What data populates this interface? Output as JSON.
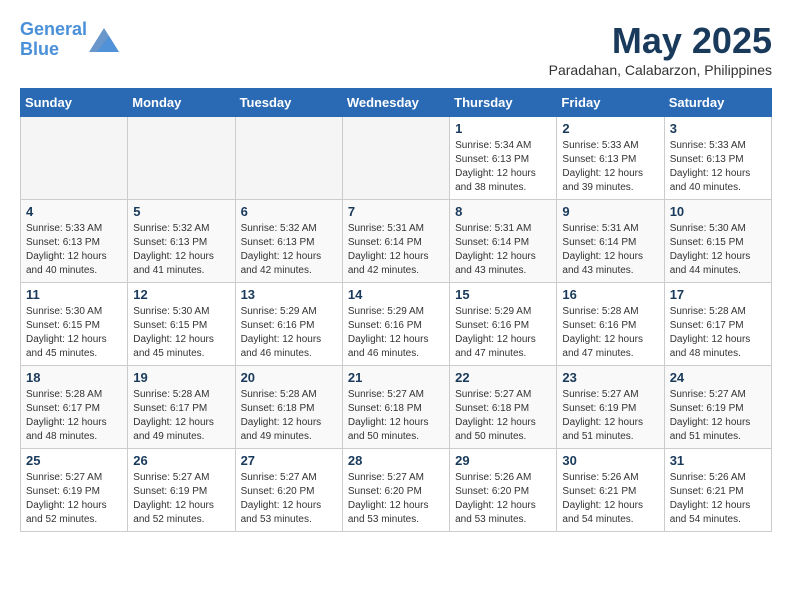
{
  "header": {
    "logo_line1": "General",
    "logo_line2": "Blue",
    "month_title": "May 2025",
    "subtitle": "Paradahan, Calabarzon, Philippines"
  },
  "days_of_week": [
    "Sunday",
    "Monday",
    "Tuesday",
    "Wednesday",
    "Thursday",
    "Friday",
    "Saturday"
  ],
  "weeks": [
    {
      "days": [
        {
          "num": "",
          "info": ""
        },
        {
          "num": "",
          "info": ""
        },
        {
          "num": "",
          "info": ""
        },
        {
          "num": "",
          "info": ""
        },
        {
          "num": "1",
          "info": "Sunrise: 5:34 AM\nSunset: 6:13 PM\nDaylight: 12 hours\nand 38 minutes."
        },
        {
          "num": "2",
          "info": "Sunrise: 5:33 AM\nSunset: 6:13 PM\nDaylight: 12 hours\nand 39 minutes."
        },
        {
          "num": "3",
          "info": "Sunrise: 5:33 AM\nSunset: 6:13 PM\nDaylight: 12 hours\nand 40 minutes."
        }
      ]
    },
    {
      "days": [
        {
          "num": "4",
          "info": "Sunrise: 5:33 AM\nSunset: 6:13 PM\nDaylight: 12 hours\nand 40 minutes."
        },
        {
          "num": "5",
          "info": "Sunrise: 5:32 AM\nSunset: 6:13 PM\nDaylight: 12 hours\nand 41 minutes."
        },
        {
          "num": "6",
          "info": "Sunrise: 5:32 AM\nSunset: 6:13 PM\nDaylight: 12 hours\nand 42 minutes."
        },
        {
          "num": "7",
          "info": "Sunrise: 5:31 AM\nSunset: 6:14 PM\nDaylight: 12 hours\nand 42 minutes."
        },
        {
          "num": "8",
          "info": "Sunrise: 5:31 AM\nSunset: 6:14 PM\nDaylight: 12 hours\nand 43 minutes."
        },
        {
          "num": "9",
          "info": "Sunrise: 5:31 AM\nSunset: 6:14 PM\nDaylight: 12 hours\nand 43 minutes."
        },
        {
          "num": "10",
          "info": "Sunrise: 5:30 AM\nSunset: 6:15 PM\nDaylight: 12 hours\nand 44 minutes."
        }
      ]
    },
    {
      "days": [
        {
          "num": "11",
          "info": "Sunrise: 5:30 AM\nSunset: 6:15 PM\nDaylight: 12 hours\nand 45 minutes."
        },
        {
          "num": "12",
          "info": "Sunrise: 5:30 AM\nSunset: 6:15 PM\nDaylight: 12 hours\nand 45 minutes."
        },
        {
          "num": "13",
          "info": "Sunrise: 5:29 AM\nSunset: 6:16 PM\nDaylight: 12 hours\nand 46 minutes."
        },
        {
          "num": "14",
          "info": "Sunrise: 5:29 AM\nSunset: 6:16 PM\nDaylight: 12 hours\nand 46 minutes."
        },
        {
          "num": "15",
          "info": "Sunrise: 5:29 AM\nSunset: 6:16 PM\nDaylight: 12 hours\nand 47 minutes."
        },
        {
          "num": "16",
          "info": "Sunrise: 5:28 AM\nSunset: 6:16 PM\nDaylight: 12 hours\nand 47 minutes."
        },
        {
          "num": "17",
          "info": "Sunrise: 5:28 AM\nSunset: 6:17 PM\nDaylight: 12 hours\nand 48 minutes."
        }
      ]
    },
    {
      "days": [
        {
          "num": "18",
          "info": "Sunrise: 5:28 AM\nSunset: 6:17 PM\nDaylight: 12 hours\nand 48 minutes."
        },
        {
          "num": "19",
          "info": "Sunrise: 5:28 AM\nSunset: 6:17 PM\nDaylight: 12 hours\nand 49 minutes."
        },
        {
          "num": "20",
          "info": "Sunrise: 5:28 AM\nSunset: 6:18 PM\nDaylight: 12 hours\nand 49 minutes."
        },
        {
          "num": "21",
          "info": "Sunrise: 5:27 AM\nSunset: 6:18 PM\nDaylight: 12 hours\nand 50 minutes."
        },
        {
          "num": "22",
          "info": "Sunrise: 5:27 AM\nSunset: 6:18 PM\nDaylight: 12 hours\nand 50 minutes."
        },
        {
          "num": "23",
          "info": "Sunrise: 5:27 AM\nSunset: 6:19 PM\nDaylight: 12 hours\nand 51 minutes."
        },
        {
          "num": "24",
          "info": "Sunrise: 5:27 AM\nSunset: 6:19 PM\nDaylight: 12 hours\nand 51 minutes."
        }
      ]
    },
    {
      "days": [
        {
          "num": "25",
          "info": "Sunrise: 5:27 AM\nSunset: 6:19 PM\nDaylight: 12 hours\nand 52 minutes."
        },
        {
          "num": "26",
          "info": "Sunrise: 5:27 AM\nSunset: 6:19 PM\nDaylight: 12 hours\nand 52 minutes."
        },
        {
          "num": "27",
          "info": "Sunrise: 5:27 AM\nSunset: 6:20 PM\nDaylight: 12 hours\nand 53 minutes."
        },
        {
          "num": "28",
          "info": "Sunrise: 5:27 AM\nSunset: 6:20 PM\nDaylight: 12 hours\nand 53 minutes."
        },
        {
          "num": "29",
          "info": "Sunrise: 5:26 AM\nSunset: 6:20 PM\nDaylight: 12 hours\nand 53 minutes."
        },
        {
          "num": "30",
          "info": "Sunrise: 5:26 AM\nSunset: 6:21 PM\nDaylight: 12 hours\nand 54 minutes."
        },
        {
          "num": "31",
          "info": "Sunrise: 5:26 AM\nSunset: 6:21 PM\nDaylight: 12 hours\nand 54 minutes."
        }
      ]
    }
  ]
}
